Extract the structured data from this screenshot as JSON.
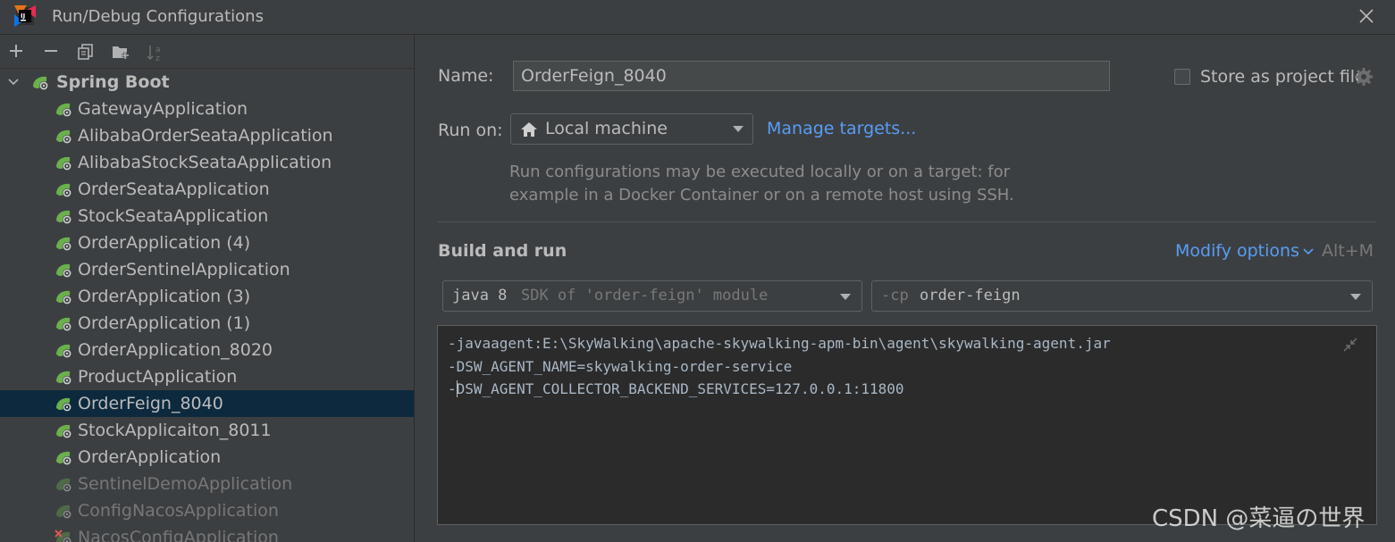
{
  "window": {
    "title": "Run/Debug Configurations"
  },
  "toolbar": {
    "add": "+",
    "remove": "−"
  },
  "tree": {
    "group_label": "Spring Boot",
    "items": [
      {
        "label": "GatewayApplication",
        "state": "normal"
      },
      {
        "label": "AlibabaOrderSeataApplication",
        "state": "normal"
      },
      {
        "label": "AlibabaStockSeataApplication",
        "state": "normal"
      },
      {
        "label": "OrderSeataApplication",
        "state": "normal"
      },
      {
        "label": "StockSeataApplication",
        "state": "normal"
      },
      {
        "label": "OrderApplication (4)",
        "state": "normal"
      },
      {
        "label": "OrderSentinelApplication",
        "state": "normal"
      },
      {
        "label": "OrderApplication (3)",
        "state": "normal"
      },
      {
        "label": "OrderApplication (1)",
        "state": "normal"
      },
      {
        "label": "OrderApplication_8020",
        "state": "normal"
      },
      {
        "label": "ProductApplication",
        "state": "normal"
      },
      {
        "label": "OrderFeign_8040",
        "state": "selected"
      },
      {
        "label": "StockApplicaiton_8011",
        "state": "normal"
      },
      {
        "label": "OrderApplication",
        "state": "normal"
      },
      {
        "label": "SentinelDemoApplication",
        "state": "disabled"
      },
      {
        "label": "ConfigNacosApplication",
        "state": "disabled"
      },
      {
        "label": "NacosConfigApplication",
        "state": "error"
      }
    ]
  },
  "form": {
    "name_label": "Name:",
    "name_value": "OrderFeign_8040",
    "store_label": "Store as project file",
    "runon_label": "Run on:",
    "runon_value": "Local machine",
    "manage_targets": "Manage targets...",
    "hint_line1": "Run configurations may be executed locally or on a target: for",
    "hint_line2": "example in a Docker Container or on a remote host using SSH.",
    "build_title": "Build and run",
    "modify_options": "Modify options",
    "modify_shortcut": "Alt+M",
    "sdk_java": "java 8",
    "sdk_desc": "SDK of 'order-feign' module",
    "cp_flag": "-cp",
    "cp_value": "order-feign",
    "vm_options": [
      "-javaagent:E:\\SkyWalking\\apache-skywalking-apm-bin\\agent\\skywalking-agent.jar",
      "-DSW_AGENT_NAME=skywalking-order-service",
      "-DSW_AGENT_COLLECTOR_BACKEND_SERVICES=127.0.0.1:11800"
    ]
  },
  "watermark": "CSDN @菜逼の世界",
  "colors": {
    "accent_link": "#589df6",
    "selection": "#0d293e",
    "spring_green": "#6ab04c"
  }
}
